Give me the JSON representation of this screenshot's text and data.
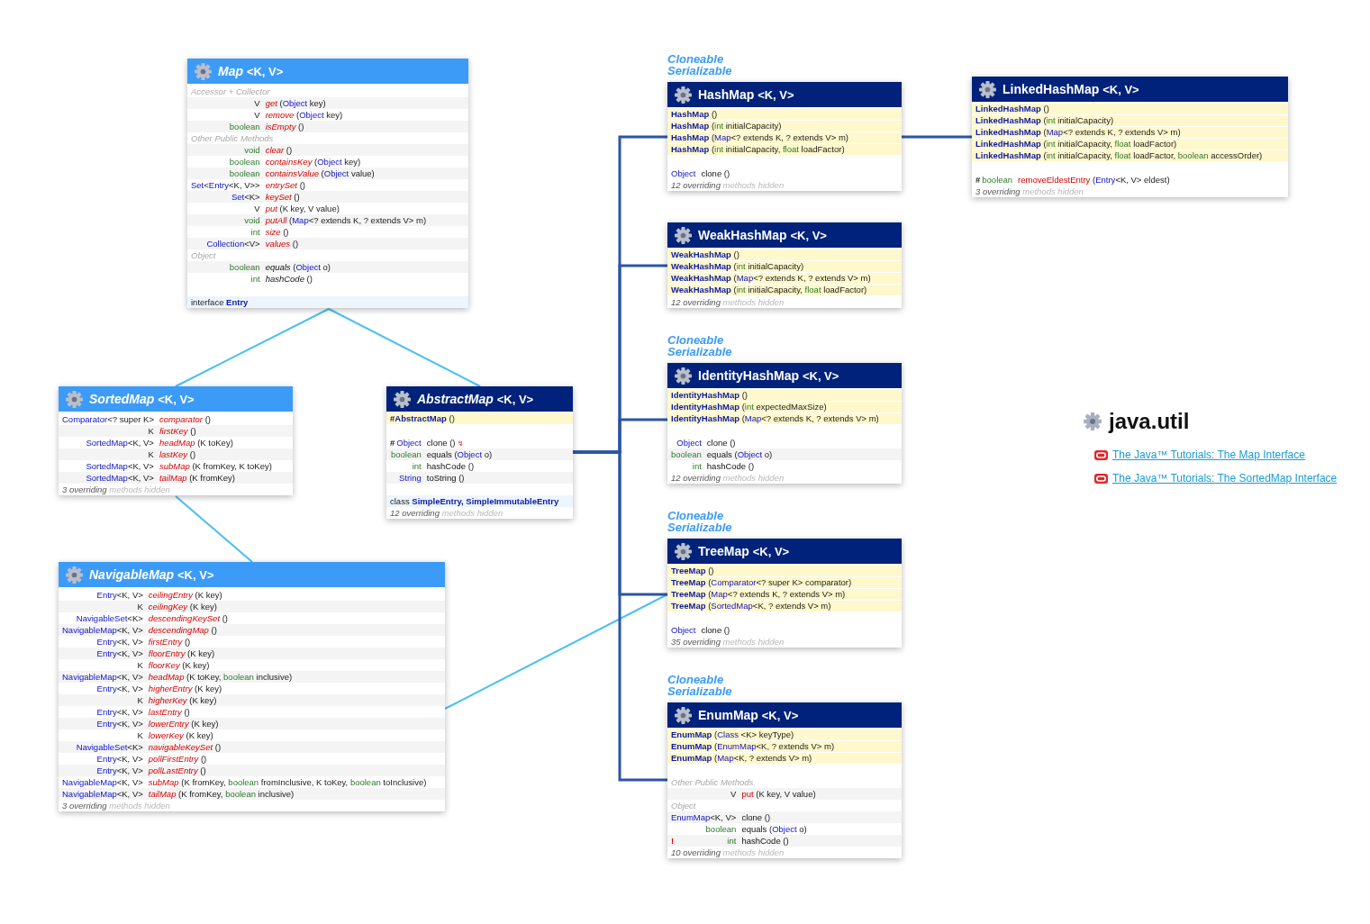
{
  "classes": [
    {
      "name": "Map",
      "type_params": "<K, V>",
      "kind": "interface",
      "members": [
        {
          "kind": "section",
          "text": "Accessor + Collector"
        },
        {
          "kind": "method",
          "returns": [
            {
              "kind": "text",
              "text": "V"
            }
          ],
          "name": "get",
          "abstract": true,
          "object_method": false,
          "params": [
            {
              "kind": "text",
              "text": "("
            },
            {
              "kind": "type",
              "text": "Object"
            },
            {
              "kind": "text",
              "text": " key)"
            }
          ]
        },
        {
          "kind": "method",
          "returns": [
            {
              "kind": "text",
              "text": "V"
            }
          ],
          "name": "remove",
          "abstract": true,
          "object_method": false,
          "params": [
            {
              "kind": "text",
              "text": "("
            },
            {
              "kind": "type",
              "text": "Object"
            },
            {
              "kind": "text",
              "text": " key)"
            }
          ]
        },
        {
          "kind": "method",
          "returns": [
            {
              "kind": "prim",
              "text": "boolean"
            }
          ],
          "name": "isEmpty",
          "abstract": true,
          "object_method": false,
          "params": [
            {
              "kind": "text",
              "text": "()"
            }
          ]
        },
        {
          "kind": "section",
          "text": "Other Public Methods"
        },
        {
          "kind": "method",
          "returns": [
            {
              "kind": "prim",
              "text": "void"
            }
          ],
          "name": "clear",
          "abstract": true,
          "object_method": false,
          "params": [
            {
              "kind": "text",
              "text": "()"
            }
          ]
        },
        {
          "kind": "method",
          "returns": [
            {
              "kind": "prim",
              "text": "boolean"
            }
          ],
          "name": "containsKey",
          "abstract": true,
          "object_method": false,
          "params": [
            {
              "kind": "text",
              "text": "("
            },
            {
              "kind": "type",
              "text": "Object"
            },
            {
              "kind": "text",
              "text": " key)"
            }
          ]
        },
        {
          "kind": "method",
          "returns": [
            {
              "kind": "prim",
              "text": "boolean"
            }
          ],
          "name": "containsValue",
          "abstract": true,
          "object_method": false,
          "params": [
            {
              "kind": "text",
              "text": "("
            },
            {
              "kind": "type",
              "text": "Object"
            },
            {
              "kind": "text",
              "text": " value)"
            }
          ]
        },
        {
          "kind": "method",
          "returns": [
            {
              "kind": "type",
              "text": "Set"
            },
            {
              "kind": "text",
              "text": "<"
            },
            {
              "kind": "type",
              "text": "Entry"
            },
            {
              "kind": "text",
              "text": "<K, V>>"
            }
          ],
          "name": "entrySet",
          "abstract": true,
          "object_method": false,
          "params": [
            {
              "kind": "text",
              "text": "()"
            }
          ]
        },
        {
          "kind": "method",
          "returns": [
            {
              "kind": "type",
              "text": "Set"
            },
            {
              "kind": "text",
              "text": "<K>"
            }
          ],
          "name": "keySet",
          "abstract": true,
          "object_method": false,
          "params": [
            {
              "kind": "text",
              "text": "()"
            }
          ]
        },
        {
          "kind": "method",
          "returns": [
            {
              "kind": "text",
              "text": "V"
            }
          ],
          "name": "put",
          "abstract": true,
          "object_method": false,
          "params": [
            {
              "kind": "text",
              "text": "(K key, V value)"
            }
          ]
        },
        {
          "kind": "method",
          "returns": [
            {
              "kind": "prim",
              "text": "void"
            }
          ],
          "name": "putAll",
          "abstract": true,
          "object_method": false,
          "params": [
            {
              "kind": "text",
              "text": "("
            },
            {
              "kind": "type",
              "text": "Map"
            },
            {
              "kind": "text",
              "text": "<? extends K, ? extends V> m)"
            }
          ]
        },
        {
          "kind": "method",
          "returns": [
            {
              "kind": "prim",
              "text": "int"
            }
          ],
          "name": "size",
          "abstract": true,
          "object_method": false,
          "params": [
            {
              "kind": "text",
              "text": "()"
            }
          ]
        },
        {
          "kind": "method",
          "returns": [
            {
              "kind": "type",
              "text": "Collection"
            },
            {
              "kind": "text",
              "text": "<V>"
            }
          ],
          "name": "values",
          "abstract": true,
          "object_method": false,
          "params": [
            {
              "kind": "text",
              "text": "()"
            }
          ]
        },
        {
          "kind": "section",
          "text": "Object"
        },
        {
          "kind": "method",
          "returns": [
            {
              "kind": "prim",
              "text": "boolean"
            }
          ],
          "name": "equals",
          "abstract": true,
          "object_method": true,
          "params": [
            {
              "kind": "text",
              "text": "("
            },
            {
              "kind": "type",
              "text": "Object"
            },
            {
              "kind": "text",
              "text": " o)"
            }
          ]
        },
        {
          "kind": "method",
          "returns": [
            {
              "kind": "prim",
              "text": "int"
            }
          ],
          "name": "hashCode",
          "abstract": true,
          "object_method": true,
          "params": [
            {
              "kind": "text",
              "text": "()"
            }
          ]
        }
      ],
      "nested": [
        {
          "kind": "text",
          "text": "interface "
        },
        {
          "kind": "nested",
          "text": "Entry"
        }
      ]
    },
    {
      "name": "SortedMap",
      "type_params": "<K, V>",
      "kind": "interface",
      "members": [
        {
          "kind": "method",
          "returns": [
            {
              "kind": "type",
              "text": "Comparator"
            },
            {
              "kind": "text",
              "text": "<? super K>"
            }
          ],
          "name": "comparator",
          "abstract": true,
          "object_method": false,
          "params": [
            {
              "kind": "text",
              "text": "()"
            }
          ]
        },
        {
          "kind": "method",
          "returns": [
            {
              "kind": "text",
              "text": "K"
            }
          ],
          "name": "firstKey",
          "abstract": true,
          "object_method": false,
          "params": [
            {
              "kind": "text",
              "text": "()"
            }
          ]
        },
        {
          "kind": "method",
          "returns": [
            {
              "kind": "type",
              "text": "SortedMap"
            },
            {
              "kind": "text",
              "text": "<K, V>"
            }
          ],
          "name": "headMap",
          "abstract": true,
          "object_method": false,
          "params": [
            {
              "kind": "text",
              "text": "(K toKey)"
            }
          ]
        },
        {
          "kind": "method",
          "returns": [
            {
              "kind": "text",
              "text": "K"
            }
          ],
          "name": "lastKey",
          "abstract": true,
          "object_method": false,
          "params": [
            {
              "kind": "text",
              "text": "()"
            }
          ]
        },
        {
          "kind": "method",
          "returns": [
            {
              "kind": "type",
              "text": "SortedMap"
            },
            {
              "kind": "text",
              "text": "<K, V>"
            }
          ],
          "name": "subMap",
          "abstract": true,
          "object_method": false,
          "params": [
            {
              "kind": "text",
              "text": "(K fromKey, K toKey)"
            }
          ]
        },
        {
          "kind": "method",
          "returns": [
            {
              "kind": "type",
              "text": "SortedMap"
            },
            {
              "kind": "text",
              "text": "<K, V>"
            }
          ],
          "name": "tailMap",
          "abstract": true,
          "object_method": false,
          "params": [
            {
              "kind": "text",
              "text": "(K fromKey)"
            }
          ]
        }
      ],
      "hidden": {
        "summary": "3 overriding",
        "detail": "methods hidden"
      }
    },
    {
      "name": "AbstractMap",
      "type_params": "<K, V>",
      "kind": "abstract_class",
      "constructors": [
        {
          "marker": {
            "kind": "protected",
            "text": "#"
          },
          "name": "AbstractMap",
          "params": [
            {
              "kind": "text",
              "text": "()"
            }
          ]
        }
      ],
      "members": [
        {
          "kind": "method",
          "marker": {
            "kind": "protected",
            "text": "#"
          },
          "returns": [
            {
              "kind": "type",
              "text": "Object"
            }
          ],
          "name": "clone",
          "abstract": false,
          "object_method": true,
          "params": [
            {
              "kind": "text",
              "text": "()"
            },
            {
              "kind": "throws",
              "text": "↯"
            }
          ]
        },
        {
          "kind": "method",
          "returns": [
            {
              "kind": "prim",
              "text": "boolean"
            }
          ],
          "name": "equals",
          "abstract": false,
          "object_method": true,
          "params": [
            {
              "kind": "text",
              "text": "("
            },
            {
              "kind": "type",
              "text": "Object"
            },
            {
              "kind": "text",
              "text": " o)"
            }
          ]
        },
        {
          "kind": "method",
          "returns": [
            {
              "kind": "prim",
              "text": "int"
            }
          ],
          "name": "hashCode",
          "abstract": false,
          "object_method": true,
          "params": [
            {
              "kind": "text",
              "text": "()"
            }
          ]
        },
        {
          "kind": "method",
          "returns": [
            {
              "kind": "type",
              "text": "String"
            }
          ],
          "name": "toString",
          "abstract": false,
          "object_method": true,
          "params": [
            {
              "kind": "text",
              "text": "()"
            }
          ]
        }
      ],
      "nested": [
        {
          "kind": "text",
          "text": "class "
        },
        {
          "kind": "nested",
          "text": "SimpleEntry, SimpleImmutableEntry"
        }
      ],
      "hidden": {
        "summary": "12 overriding",
        "detail": "methods hidden"
      }
    },
    {
      "name": "NavigableMap",
      "type_params": "<K, V>",
      "kind": "interface",
      "members": [
        {
          "kind": "method",
          "returns": [
            {
              "kind": "type",
              "text": "Entry"
            },
            {
              "kind": "text",
              "text": "<K, V>"
            }
          ],
          "name": "ceilingEntry",
          "abstract": true,
          "object_method": false,
          "params": [
            {
              "kind": "text",
              "text": "(K key)"
            }
          ]
        },
        {
          "kind": "method",
          "returns": [
            {
              "kind": "text",
              "text": "K"
            }
          ],
          "name": "ceilingKey",
          "abstract": true,
          "object_method": false,
          "params": [
            {
              "kind": "text",
              "text": "(K key)"
            }
          ]
        },
        {
          "kind": "method",
          "returns": [
            {
              "kind": "type",
              "text": "NavigableSet"
            },
            {
              "kind": "text",
              "text": "<K>"
            }
          ],
          "name": "descendingKeySet",
          "abstract": true,
          "object_method": false,
          "params": [
            {
              "kind": "text",
              "text": "()"
            }
          ]
        },
        {
          "kind": "method",
          "returns": [
            {
              "kind": "type",
              "text": "NavigableMap"
            },
            {
              "kind": "text",
              "text": "<K, V>"
            }
          ],
          "name": "descendingMap",
          "abstract": true,
          "object_method": false,
          "params": [
            {
              "kind": "text",
              "text": "()"
            }
          ]
        },
        {
          "kind": "method",
          "returns": [
            {
              "kind": "type",
              "text": "Entry"
            },
            {
              "kind": "text",
              "text": "<K, V>"
            }
          ],
          "name": "firstEntry",
          "abstract": true,
          "object_method": false,
          "params": [
            {
              "kind": "text",
              "text": "()"
            }
          ]
        },
        {
          "kind": "method",
          "returns": [
            {
              "kind": "type",
              "text": "Entry"
            },
            {
              "kind": "text",
              "text": "<K, V>"
            }
          ],
          "name": "floorEntry",
          "abstract": true,
          "object_method": false,
          "params": [
            {
              "kind": "text",
              "text": "(K key)"
            }
          ]
        },
        {
          "kind": "method",
          "returns": [
            {
              "kind": "text",
              "text": "K"
            }
          ],
          "name": "floorKey",
          "abstract": true,
          "object_method": false,
          "params": [
            {
              "kind": "text",
              "text": "(K key)"
            }
          ]
        },
        {
          "kind": "method",
          "returns": [
            {
              "kind": "type",
              "text": "NavigableMap"
            },
            {
              "kind": "text",
              "text": "<K, V>"
            }
          ],
          "name": "headMap",
          "abstract": true,
          "object_method": false,
          "params": [
            {
              "kind": "text",
              "text": "(K toKey, "
            },
            {
              "kind": "prim",
              "text": "boolean"
            },
            {
              "kind": "text",
              "text": " inclusive)"
            }
          ]
        },
        {
          "kind": "method",
          "returns": [
            {
              "kind": "type",
              "text": "Entry"
            },
            {
              "kind": "text",
              "text": "<K, V>"
            }
          ],
          "name": "higherEntry",
          "abstract": true,
          "object_method": false,
          "params": [
            {
              "kind": "text",
              "text": "(K key)"
            }
          ]
        },
        {
          "kind": "method",
          "returns": [
            {
              "kind": "text",
              "text": "K"
            }
          ],
          "name": "higherKey",
          "abstract": true,
          "object_method": false,
          "params": [
            {
              "kind": "text",
              "text": "(K key)"
            }
          ]
        },
        {
          "kind": "method",
          "returns": [
            {
              "kind": "type",
              "text": "Entry"
            },
            {
              "kind": "text",
              "text": "<K, V>"
            }
          ],
          "name": "lastEntry",
          "abstract": true,
          "object_method": false,
          "params": [
            {
              "kind": "text",
              "text": "()"
            }
          ]
        },
        {
          "kind": "method",
          "returns": [
            {
              "kind": "type",
              "text": "Entry"
            },
            {
              "kind": "text",
              "text": "<K, V>"
            }
          ],
          "name": "lowerEntry",
          "abstract": true,
          "object_method": false,
          "params": [
            {
              "kind": "text",
              "text": "(K key)"
            }
          ]
        },
        {
          "kind": "method",
          "returns": [
            {
              "kind": "text",
              "text": "K"
            }
          ],
          "name": "lowerKey",
          "abstract": true,
          "object_method": false,
          "params": [
            {
              "kind": "text",
              "text": "(K key)"
            }
          ]
        },
        {
          "kind": "method",
          "returns": [
            {
              "kind": "type",
              "text": "NavigableSet"
            },
            {
              "kind": "text",
              "text": "<K>"
            }
          ],
          "name": "navigableKeySet",
          "abstract": true,
          "object_method": false,
          "params": [
            {
              "kind": "text",
              "text": "()"
            }
          ]
        },
        {
          "kind": "method",
          "returns": [
            {
              "kind": "type",
              "text": "Entry"
            },
            {
              "kind": "text",
              "text": "<K, V>"
            }
          ],
          "name": "pollFirstEntry",
          "abstract": true,
          "object_method": false,
          "params": [
            {
              "kind": "text",
              "text": "()"
            }
          ]
        },
        {
          "kind": "method",
          "returns": [
            {
              "kind": "type",
              "text": "Entry"
            },
            {
              "kind": "text",
              "text": "<K, V>"
            }
          ],
          "name": "pollLastEntry",
          "abstract": true,
          "object_method": false,
          "params": [
            {
              "kind": "text",
              "text": "()"
            }
          ]
        },
        {
          "kind": "method",
          "returns": [
            {
              "kind": "type",
              "text": "NavigableMap"
            },
            {
              "kind": "text",
              "text": "<K, V>"
            }
          ],
          "name": "subMap",
          "abstract": true,
          "object_method": false,
          "params": [
            {
              "kind": "text",
              "text": "(K fromKey, "
            },
            {
              "kind": "prim",
              "text": "boolean"
            },
            {
              "kind": "text",
              "text": " fromInclusive, K toKey, "
            },
            {
              "kind": "prim",
              "text": "boolean"
            },
            {
              "kind": "text",
              "text": " toInclusive)"
            }
          ]
        },
        {
          "kind": "method",
          "returns": [
            {
              "kind": "type",
              "text": "NavigableMap"
            },
            {
              "kind": "text",
              "text": "<K, V>"
            }
          ],
          "name": "tailMap",
          "abstract": true,
          "object_method": false,
          "params": [
            {
              "kind": "text",
              "text": "(K fromKey, "
            },
            {
              "kind": "prim",
              "text": "boolean"
            },
            {
              "kind": "text",
              "text": " inclusive)"
            }
          ]
        }
      ],
      "hidden": {
        "summary": "3 overriding",
        "detail": "methods hidden"
      }
    },
    {
      "name": "HashMap",
      "type_params": "<K, V>",
      "kind": "class",
      "implements": [
        "Cloneable",
        "Serializable"
      ],
      "constructors": [
        {
          "name": "HashMap",
          "params": [
            {
              "kind": "text",
              "text": "()"
            }
          ]
        },
        {
          "name": "HashMap",
          "params": [
            {
              "kind": "text",
              "text": "("
            },
            {
              "kind": "prim",
              "text": "int"
            },
            {
              "kind": "text",
              "text": " initialCapacity)"
            }
          ]
        },
        {
          "name": "HashMap",
          "params": [
            {
              "kind": "text",
              "text": "("
            },
            {
              "kind": "type",
              "text": "Map"
            },
            {
              "kind": "text",
              "text": "<? extends K, ? extends V> m)"
            }
          ]
        },
        {
          "name": "HashMap",
          "params": [
            {
              "kind": "text",
              "text": "("
            },
            {
              "kind": "prim",
              "text": "int"
            },
            {
              "kind": "text",
              "text": " initialCapacity, "
            },
            {
              "kind": "prim",
              "text": "float"
            },
            {
              "kind": "text",
              "text": " loadFactor)"
            }
          ]
        }
      ],
      "members": [
        {
          "kind": "method",
          "returns": [
            {
              "kind": "type",
              "text": "Object"
            }
          ],
          "name": "clone",
          "abstract": false,
          "object_method": true,
          "params": [
            {
              "kind": "text",
              "text": "()"
            }
          ]
        }
      ],
      "hidden": {
        "summary": "12 overriding",
        "detail": "methods hidden"
      }
    },
    {
      "name": "LinkedHashMap",
      "type_params": "<K, V>",
      "kind": "class",
      "constructors": [
        {
          "name": "LinkedHashMap",
          "params": [
            {
              "kind": "text",
              "text": "()"
            }
          ]
        },
        {
          "name": "LinkedHashMap",
          "params": [
            {
              "kind": "text",
              "text": "("
            },
            {
              "kind": "prim",
              "text": "int"
            },
            {
              "kind": "text",
              "text": " initialCapacity)"
            }
          ]
        },
        {
          "name": "LinkedHashMap",
          "params": [
            {
              "kind": "text",
              "text": "("
            },
            {
              "kind": "type",
              "text": "Map"
            },
            {
              "kind": "text",
              "text": "<? extends K, ? extends V> m)"
            }
          ]
        },
        {
          "name": "LinkedHashMap",
          "params": [
            {
              "kind": "text",
              "text": "("
            },
            {
              "kind": "prim",
              "text": "int"
            },
            {
              "kind": "text",
              "text": " initialCapacity, "
            },
            {
              "kind": "prim",
              "text": "float"
            },
            {
              "kind": "text",
              "text": " loadFactor)"
            }
          ]
        },
        {
          "name": "LinkedHashMap",
          "params": [
            {
              "kind": "text",
              "text": "("
            },
            {
              "kind": "prim",
              "text": "int"
            },
            {
              "kind": "text",
              "text": " initialCapacity, "
            },
            {
              "kind": "prim",
              "text": "float"
            },
            {
              "kind": "text",
              "text": " loadFactor, "
            },
            {
              "kind": "prim",
              "text": "boolean"
            },
            {
              "kind": "text",
              "text": " accessOrder)"
            }
          ]
        }
      ],
      "members": [
        {
          "kind": "method",
          "marker": {
            "kind": "protected",
            "text": "#"
          },
          "returns": [
            {
              "kind": "prim",
              "text": "boolean"
            }
          ],
          "name": "removeEldestEntry",
          "abstract": false,
          "object_method": false,
          "params": [
            {
              "kind": "text",
              "text": "("
            },
            {
              "kind": "type",
              "text": "Entry"
            },
            {
              "kind": "text",
              "text": "<K, V> eldest)"
            }
          ]
        }
      ],
      "hidden": {
        "summary": "3 overriding",
        "detail": "methods hidden"
      }
    },
    {
      "name": "WeakHashMap",
      "type_params": "<K, V>",
      "kind": "class",
      "constructors": [
        {
          "name": "WeakHashMap",
          "params": [
            {
              "kind": "text",
              "text": "()"
            }
          ]
        },
        {
          "name": "WeakHashMap",
          "params": [
            {
              "kind": "text",
              "text": "("
            },
            {
              "kind": "prim",
              "text": "int"
            },
            {
              "kind": "text",
              "text": " initialCapacity)"
            }
          ]
        },
        {
          "name": "WeakHashMap",
          "params": [
            {
              "kind": "text",
              "text": "("
            },
            {
              "kind": "type",
              "text": "Map"
            },
            {
              "kind": "text",
              "text": "<? extends K, ? extends V> m)"
            }
          ]
        },
        {
          "name": "WeakHashMap",
          "params": [
            {
              "kind": "text",
              "text": "("
            },
            {
              "kind": "prim",
              "text": "int"
            },
            {
              "kind": "text",
              "text": " initialCapacity, "
            },
            {
              "kind": "prim",
              "text": "float"
            },
            {
              "kind": "text",
              "text": " loadFactor)"
            }
          ]
        }
      ],
      "hidden": {
        "summary": "12 overriding",
        "detail": "methods hidden"
      }
    },
    {
      "name": "IdentityHashMap",
      "type_params": "<K, V>",
      "kind": "class",
      "implements": [
        "Cloneable",
        "Serializable"
      ],
      "constructors": [
        {
          "name": "IdentityHashMap",
          "params": [
            {
              "kind": "text",
              "text": "()"
            }
          ]
        },
        {
          "name": "IdentityHashMap",
          "params": [
            {
              "kind": "text",
              "text": "("
            },
            {
              "kind": "prim",
              "text": "int"
            },
            {
              "kind": "text",
              "text": " expectedMaxSize)"
            }
          ]
        },
        {
          "name": "IdentityHashMap",
          "params": [
            {
              "kind": "text",
              "text": "("
            },
            {
              "kind": "type",
              "text": "Map"
            },
            {
              "kind": "text",
              "text": "<? extends K, ? extends V> m)"
            }
          ]
        }
      ],
      "members": [
        {
          "kind": "method",
          "returns": [
            {
              "kind": "type",
              "text": "Object"
            }
          ],
          "name": "clone",
          "abstract": false,
          "object_method": true,
          "params": [
            {
              "kind": "text",
              "text": "()"
            }
          ]
        },
        {
          "kind": "method",
          "returns": [
            {
              "kind": "prim",
              "text": "boolean"
            }
          ],
          "name": "equals",
          "abstract": false,
          "object_method": true,
          "params": [
            {
              "kind": "text",
              "text": "("
            },
            {
              "kind": "type",
              "text": "Object"
            },
            {
              "kind": "text",
              "text": " o)"
            }
          ]
        },
        {
          "kind": "method",
          "returns": [
            {
              "kind": "prim",
              "text": "int"
            }
          ],
          "name": "hashCode",
          "abstract": false,
          "object_method": true,
          "params": [
            {
              "kind": "text",
              "text": "()"
            }
          ]
        }
      ],
      "hidden": {
        "summary": "12 overriding",
        "detail": "methods hidden"
      }
    },
    {
      "name": "TreeMap",
      "type_params": "<K, V>",
      "kind": "class",
      "implements": [
        "Cloneable",
        "Serializable"
      ],
      "constructors": [
        {
          "name": "TreeMap",
          "params": [
            {
              "kind": "text",
              "text": "()"
            }
          ]
        },
        {
          "name": "TreeMap",
          "params": [
            {
              "kind": "text",
              "text": "("
            },
            {
              "kind": "type",
              "text": "Comparator"
            },
            {
              "kind": "text",
              "text": "<? super K> comparator)"
            }
          ]
        },
        {
          "name": "TreeMap",
          "params": [
            {
              "kind": "text",
              "text": "("
            },
            {
              "kind": "type",
              "text": "Map"
            },
            {
              "kind": "text",
              "text": "<? extends K, ? extends V> m)"
            }
          ]
        },
        {
          "name": "TreeMap",
          "params": [
            {
              "kind": "text",
              "text": "("
            },
            {
              "kind": "type",
              "text": "SortedMap"
            },
            {
              "kind": "text",
              "text": "<K, ? extends V> m)"
            }
          ]
        }
      ],
      "members": [
        {
          "kind": "method",
          "returns": [
            {
              "kind": "type",
              "text": "Object"
            }
          ],
          "name": "clone",
          "abstract": false,
          "object_method": true,
          "params": [
            {
              "kind": "text",
              "text": "()"
            }
          ]
        }
      ],
      "hidden": {
        "summary": "35 overriding",
        "detail": "methods hidden"
      }
    },
    {
      "name": "EnumMap",
      "type_params": "<K, V>",
      "kind": "class",
      "implements": [
        "Cloneable",
        "Serializable"
      ],
      "constructors": [
        {
          "name": "EnumMap",
          "params": [
            {
              "kind": "text",
              "text": "("
            },
            {
              "kind": "type",
              "text": "Class"
            },
            {
              "kind": "text",
              "text": " <K> keyType)"
            }
          ]
        },
        {
          "name": "EnumMap",
          "params": [
            {
              "kind": "text",
              "text": "("
            },
            {
              "kind": "type",
              "text": "EnumMap"
            },
            {
              "kind": "text",
              "text": "<K, ? extends V> m)"
            }
          ]
        },
        {
          "name": "EnumMap",
          "params": [
            {
              "kind": "text",
              "text": "("
            },
            {
              "kind": "type",
              "text": "Map"
            },
            {
              "kind": "text",
              "text": "<K, ? extends V> m)"
            }
          ]
        }
      ],
      "members": [
        {
          "kind": "section",
          "text": "Other Public Methods"
        },
        {
          "kind": "method",
          "returns": [
            {
              "kind": "text",
              "text": "V"
            }
          ],
          "name": "put",
          "abstract": false,
          "object_method": false,
          "params": [
            {
              "kind": "text",
              "text": "(K key, V value)"
            }
          ]
        },
        {
          "kind": "section",
          "text": "Object"
        },
        {
          "kind": "method",
          "returns": [
            {
              "kind": "type",
              "text": "EnumMap"
            },
            {
              "kind": "text",
              "text": "<K, V>"
            }
          ],
          "name": "clone",
          "abstract": false,
          "object_method": true,
          "params": [
            {
              "kind": "text",
              "text": "()"
            }
          ]
        },
        {
          "kind": "method",
          "returns": [
            {
              "kind": "prim",
              "text": "boolean"
            }
          ],
          "name": "equals",
          "abstract": false,
          "object_method": true,
          "params": [
            {
              "kind": "text",
              "text": "("
            },
            {
              "kind": "type",
              "text": "Object"
            },
            {
              "kind": "text",
              "text": " o)"
            }
          ]
        },
        {
          "kind": "method",
          "marker": {
            "kind": "warning",
            "text": "!"
          },
          "returns": [
            {
              "kind": "prim",
              "text": "int"
            }
          ],
          "name": "hashCode",
          "abstract": false,
          "object_method": true,
          "params": [
            {
              "kind": "text",
              "text": "()"
            }
          ]
        }
      ],
      "hidden": {
        "summary": "10 overriding",
        "detail": "methods hidden"
      }
    }
  ],
  "package": {
    "title": "java.util",
    "links": [
      "The Java™ Tutorials: The Map Interface",
      "The Java™ Tutorials: The SortedMap Interface"
    ]
  }
}
